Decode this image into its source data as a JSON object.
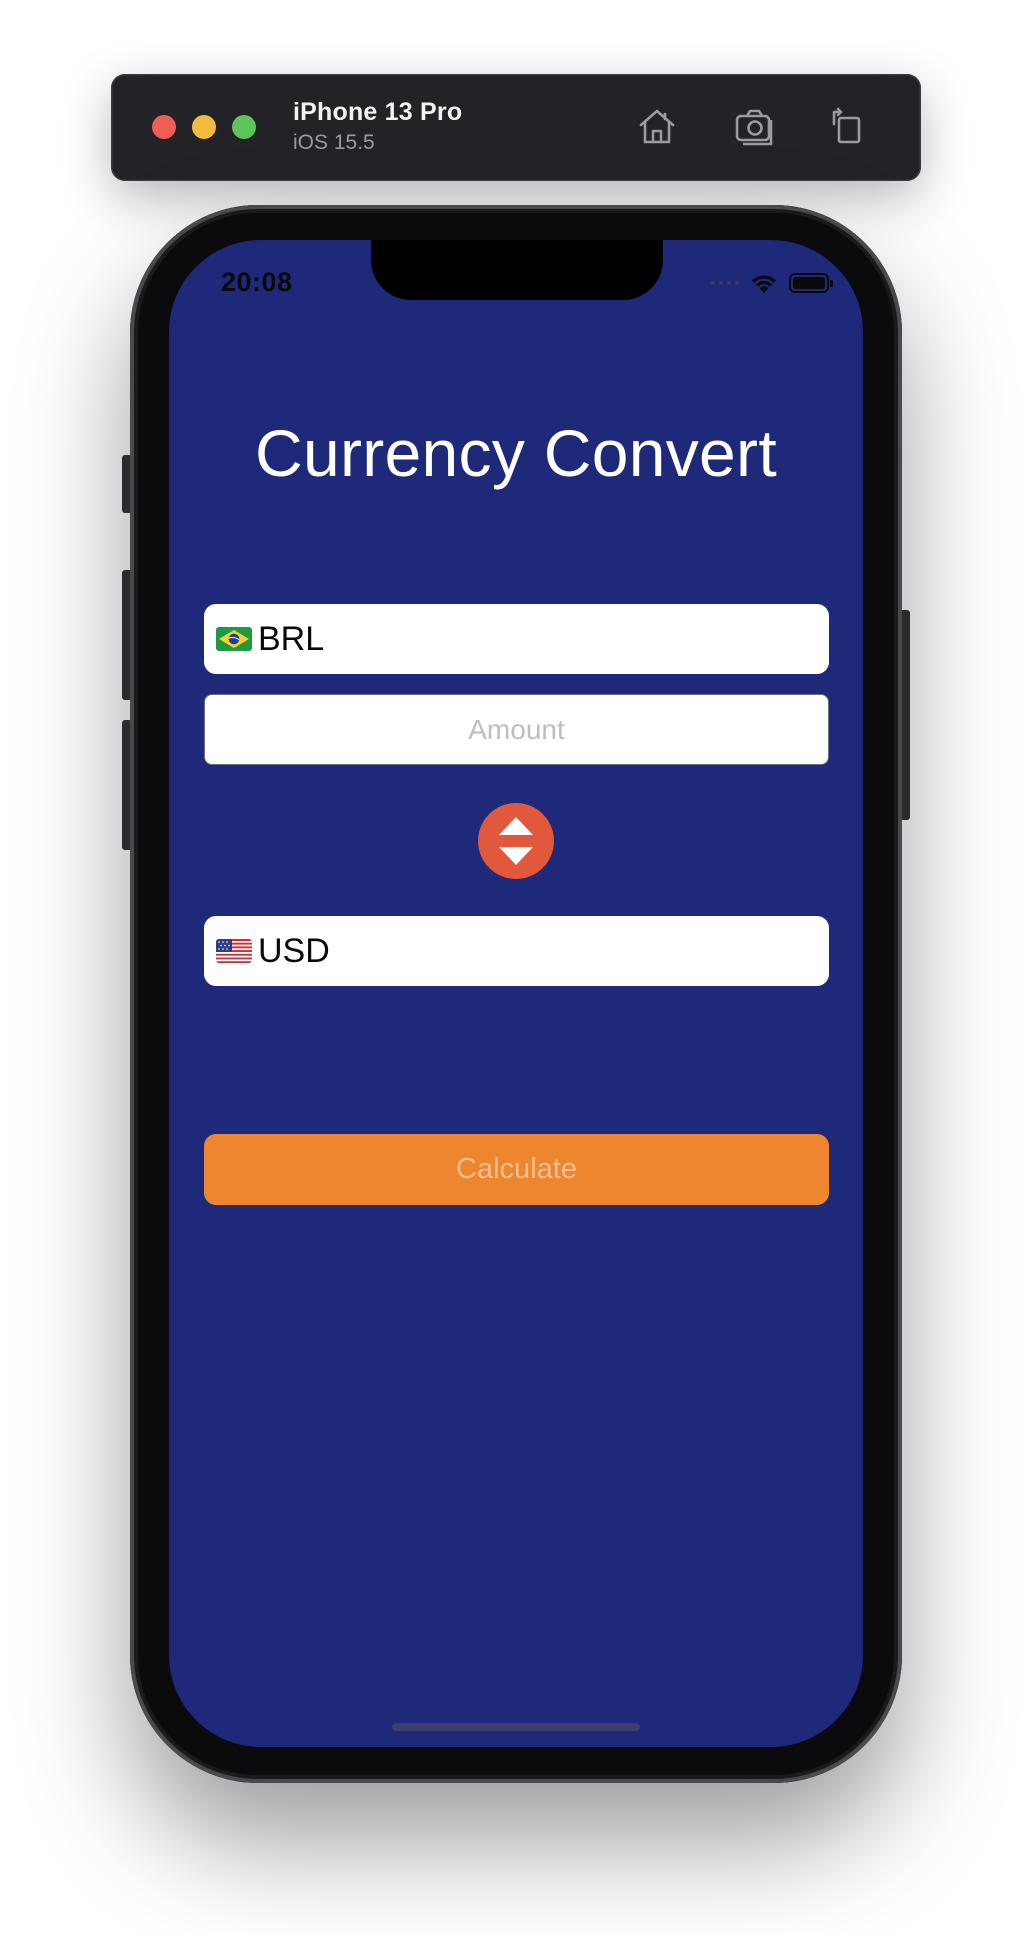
{
  "simulator": {
    "device_name": "iPhone 13 Pro",
    "os_version": "iOS 15.5",
    "toolbar_icons": [
      "home-icon",
      "screenshot-icon",
      "rotate-icon"
    ],
    "window_controls": [
      "close",
      "minimize",
      "zoom"
    ]
  },
  "status_bar": {
    "time": "20:08",
    "icons": [
      "cellular-signal-icon",
      "wifi-icon",
      "battery-icon"
    ]
  },
  "app": {
    "title": "Currency Convert",
    "from_currency": {
      "flag": "brazil-flag-icon",
      "code": "BRL"
    },
    "amount": {
      "value": "",
      "placeholder": "Amount"
    },
    "swap_icon": "swap-arrows-icon",
    "to_currency": {
      "flag": "usa-flag-icon",
      "code": "USD"
    },
    "calculate_label": "Calculate"
  },
  "colors": {
    "background": "#1f297a",
    "accent_button": "#ee852f",
    "swap_button": "#e2583c",
    "field_background": "#ffffff",
    "title_text": "#ffffff"
  }
}
